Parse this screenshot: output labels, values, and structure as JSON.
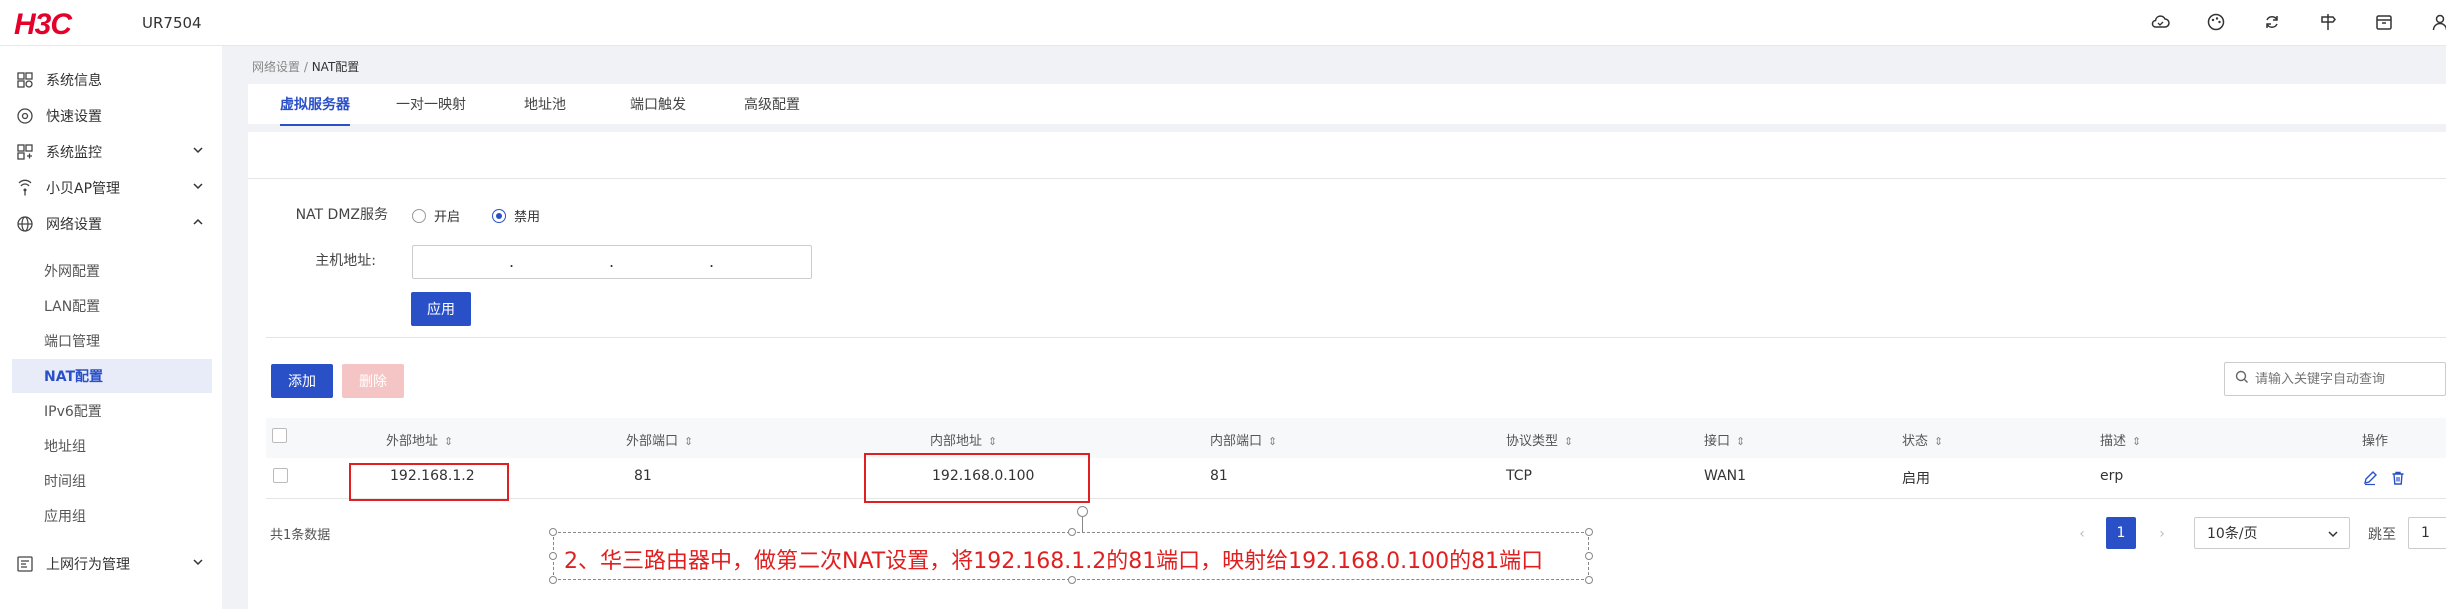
{
  "header": {
    "logo": "H3C",
    "model": "UR7504",
    "icons": [
      "cloud-icon",
      "palette-icon",
      "refresh-icon",
      "signpost-icon",
      "box-icon",
      "user-icon"
    ]
  },
  "sidebar": {
    "items": [
      {
        "label": "系统信息",
        "icon": "dashboard-icon"
      },
      {
        "label": "快速设置",
        "icon": "gear-icon"
      },
      {
        "label": "系统监控",
        "icon": "monitor-icon"
      },
      {
        "label": "小贝AP管理",
        "icon": "wifi-icon"
      },
      {
        "label": "网络设置",
        "icon": "globe-icon"
      },
      {
        "label": "上网行为管理",
        "icon": "behavior-icon"
      }
    ],
    "sub_items": [
      "外网配置",
      "LAN配置",
      "端口管理",
      "NAT配置",
      "IPv6配置",
      "地址组",
      "时间组",
      "应用组"
    ]
  },
  "breadcrumb": {
    "parent": "网络设置 / ",
    "current": "NAT配置"
  },
  "tabs": [
    "虚拟服务器",
    "一对一映射",
    "地址池",
    "端口触发",
    "高级配置"
  ],
  "dmz": {
    "label": "NAT DMZ服务",
    "option_on": "开启",
    "option_off": "禁用",
    "selected": "禁用",
    "host_label": "主机地址:",
    "apply": "应用"
  },
  "toolbar": {
    "add": "添加",
    "delete": "删除",
    "search_placeholder": "请输入关键字自动查询"
  },
  "table": {
    "columns": [
      "外部地址",
      "外部端口",
      "内部地址",
      "内部端口",
      "协议类型",
      "接口",
      "状态",
      "描述",
      "操作"
    ],
    "rows": [
      {
        "ext_addr": "192.168.1.2",
        "ext_port": "81",
        "int_addr": "192.168.0.100",
        "int_port": "81",
        "protocol": "TCP",
        "interface": "WAN1",
        "status": "启用",
        "desc": "erp"
      }
    ]
  },
  "footer": {
    "total": "共1条数据",
    "page": "1",
    "page_size": "10条/页",
    "jump": "跳至",
    "jump_value": "1"
  },
  "annotation": "2、华三路由器中，做第二次NAT设置，将192.168.1.2的81端口，映射给192.168.0.100的81端口",
  "colors": {
    "brand": "#e4002b",
    "primary": "#2a50c8",
    "highlight": "#e02020"
  }
}
